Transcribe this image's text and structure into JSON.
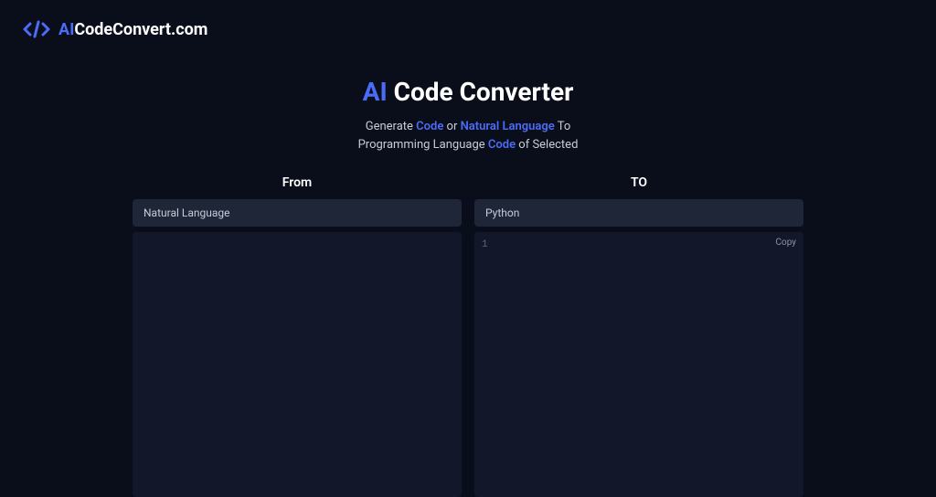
{
  "header": {
    "logo_ai": "AI",
    "logo_text": "CodeConvert.com"
  },
  "hero": {
    "title_ai": "AI",
    "title_rest": " Code Converter",
    "subtitle_line1_pre": "Generate ",
    "subtitle_line1_code": "Code",
    "subtitle_line1_or": " or ",
    "subtitle_line1_nl": "Natural Language",
    "subtitle_line1_post": " To",
    "subtitle_line2_pre": "Programming Language ",
    "subtitle_line2_code": "Code",
    "subtitle_line2_post": " of Selected"
  },
  "converter": {
    "from": {
      "label": "From",
      "selected": "Natural Language"
    },
    "to": {
      "label": "TO",
      "selected": "Python",
      "line_number": "1",
      "copy_label": "Copy"
    }
  }
}
